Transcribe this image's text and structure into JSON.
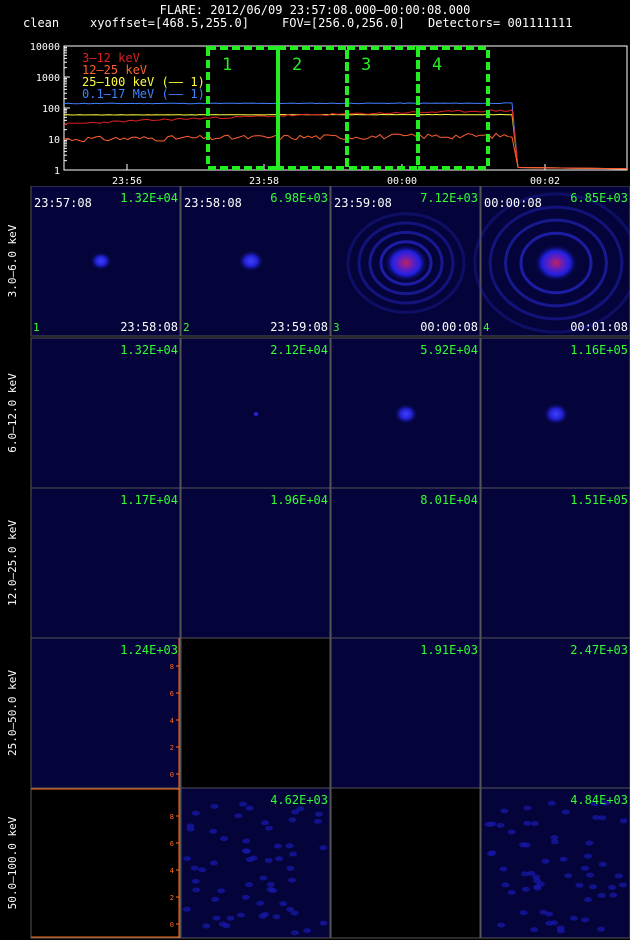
{
  "header": {
    "title": "FLARE: 2012/06/09 23:57:08.000–00:00:08.000",
    "method": "clean",
    "xyoffset": "xyoffset=[468.5,255.0]",
    "fov": "FOV=[256.0,256.0]",
    "detectors": "Detectors= 001111111"
  },
  "lightcurve": {
    "y_ticks": [
      "10000",
      "1000",
      "100",
      "10",
      "1"
    ],
    "x_ticks": [
      "23:56",
      "23:58",
      "00:00",
      "00:02"
    ],
    "legend": [
      {
        "label": "3–12 keV",
        "color": "#e02020"
      },
      {
        "label": "12–25 keV",
        "color": "#ff6030"
      },
      {
        "label": "25–100 keV (—— 1)",
        "color": "#ffff40"
      },
      {
        "label": "0.1–17 MeV (—— 1)",
        "color": "#4080ff"
      }
    ],
    "intervals": [
      "1",
      "2",
      "3",
      "4"
    ],
    "interval_color": "#22ee22"
  },
  "energy_bands": [
    "3.0–6.0 keV",
    "6.0–12.0 keV",
    "12.0–25.0 keV",
    "25.0–50.0 keV",
    "50.0–100.0 keV"
  ],
  "images": [
    [
      {
        "max": "1.32E+04",
        "t_start": "23:57:08",
        "t_end": "23:58:08",
        "index": "1",
        "blob": 0.5,
        "halo": 0
      },
      {
        "max": "6.98E+03",
        "t_start": "23:58:08",
        "t_end": "23:59:08",
        "index": "2",
        "blob": 0.6,
        "halo": 0
      },
      {
        "max": "7.12E+03",
        "t_start": "23:59:08",
        "t_end": "00:00:08",
        "index": "3",
        "blob": 1,
        "halo": 1
      },
      {
        "max": "6.85E+03",
        "t_start": "00:00:08",
        "t_end": "00:01:08",
        "index": "4",
        "blob": 1,
        "halo": 1.4
      }
    ],
    [
      {
        "max": "1.32E+04",
        "blob": 0
      },
      {
        "max": "2.12E+04",
        "blob": 0.15
      },
      {
        "max": "5.92E+04",
        "blob": 0.55
      },
      {
        "max": "1.16E+05",
        "blob": 0.6
      }
    ],
    [
      {
        "max": "1.17E+04",
        "blob": 0
      },
      {
        "max": "1.96E+04",
        "blob": 0
      },
      {
        "max": "8.01E+04",
        "blob": 0
      },
      {
        "max": "1.51E+05",
        "blob": 0
      }
    ],
    [
      {
        "max": "1.24E+03",
        "blob": 0,
        "axis": true
      },
      {
        "max": "",
        "blob": 0,
        "empty": true
      },
      {
        "max": "1.91E+03",
        "blob": 0
      },
      {
        "max": "2.47E+03",
        "blob": 0
      }
    ],
    [
      {
        "max": "",
        "blob": 0,
        "empty": true,
        "axis": true
      },
      {
        "max": "4.62E+03",
        "blob": 0,
        "noise": true
      },
      {
        "max": "",
        "blob": 0,
        "empty": true
      },
      {
        "max": "4.84E+03",
        "blob": 0,
        "noise": true
      }
    ]
  ],
  "axis_ticks": [
    "8",
    "6",
    "4",
    "2",
    "0"
  ],
  "colors": {
    "label_green": "#33ff33",
    "panel_bg": "#04043a",
    "axis_orange": "#ff6a20"
  }
}
